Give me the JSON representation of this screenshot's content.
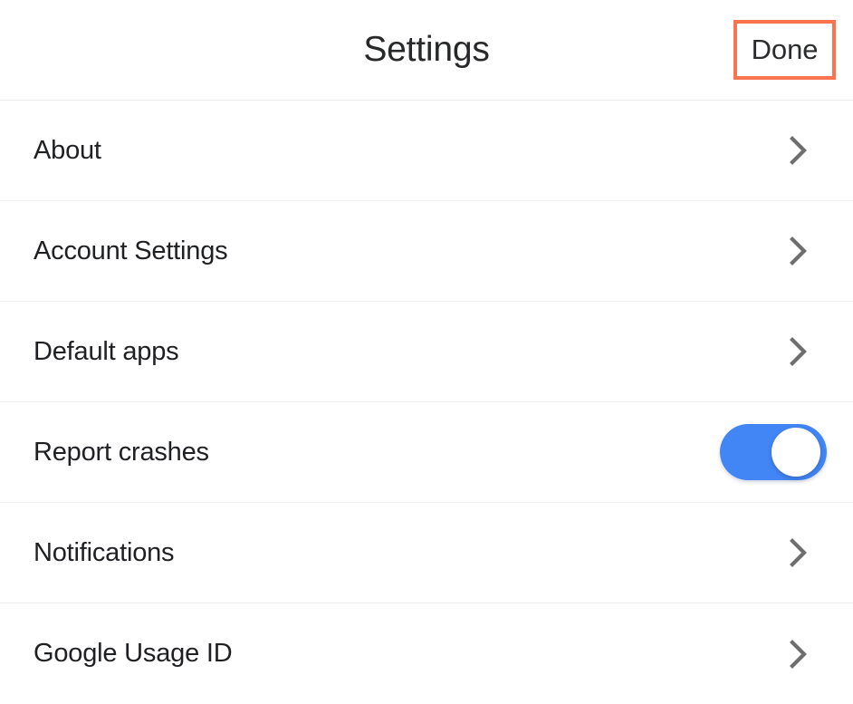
{
  "header": {
    "title": "Settings",
    "done_label": "Done",
    "highlight_color": "#f9744f"
  },
  "colors": {
    "accent_blue": "#4285f4",
    "highlight": "#f9744f",
    "text": "#1f2023",
    "divider": "#efefef",
    "chevron": "#6e6e6e"
  },
  "list": {
    "rows": [
      {
        "label": "About",
        "control": "chevron",
        "icon": "chevron-right-icon"
      },
      {
        "label": "Account Settings",
        "control": "chevron",
        "icon": "chevron-right-icon"
      },
      {
        "label": "Default apps",
        "control": "chevron",
        "icon": "chevron-right-icon"
      },
      {
        "label": "Report crashes",
        "control": "toggle",
        "toggle_state": "on"
      },
      {
        "label": "Notifications",
        "control": "chevron",
        "icon": "chevron-right-icon"
      },
      {
        "label": "Google Usage ID",
        "control": "chevron",
        "icon": "chevron-right-icon"
      }
    ]
  }
}
